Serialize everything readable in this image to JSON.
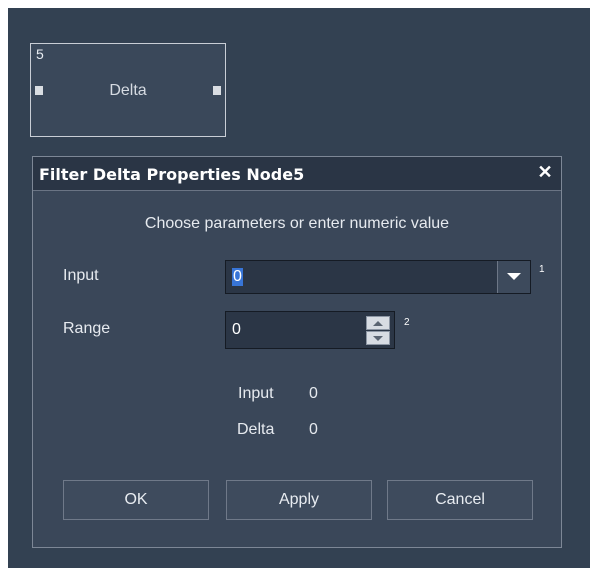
{
  "node": {
    "id": "5",
    "label": "Delta"
  },
  "dialog": {
    "title": "Filter Delta Properties Node5",
    "close_label": "✕",
    "instruction": "Choose parameters or enter numeric value",
    "fields": {
      "input": {
        "label": "Input",
        "value": "0",
        "index": "1"
      },
      "range": {
        "label": "Range",
        "value": "0",
        "index": "2"
      }
    },
    "readouts": {
      "input": {
        "label": "Input",
        "value": "0"
      },
      "delta": {
        "label": "Delta",
        "value": "0"
      }
    },
    "buttons": {
      "ok": "OK",
      "apply": "Apply",
      "cancel": "Cancel"
    }
  },
  "colors": {
    "canvas_bg": "#334152",
    "dialog_bg": "#3a4759",
    "selection": "#3875d7"
  }
}
